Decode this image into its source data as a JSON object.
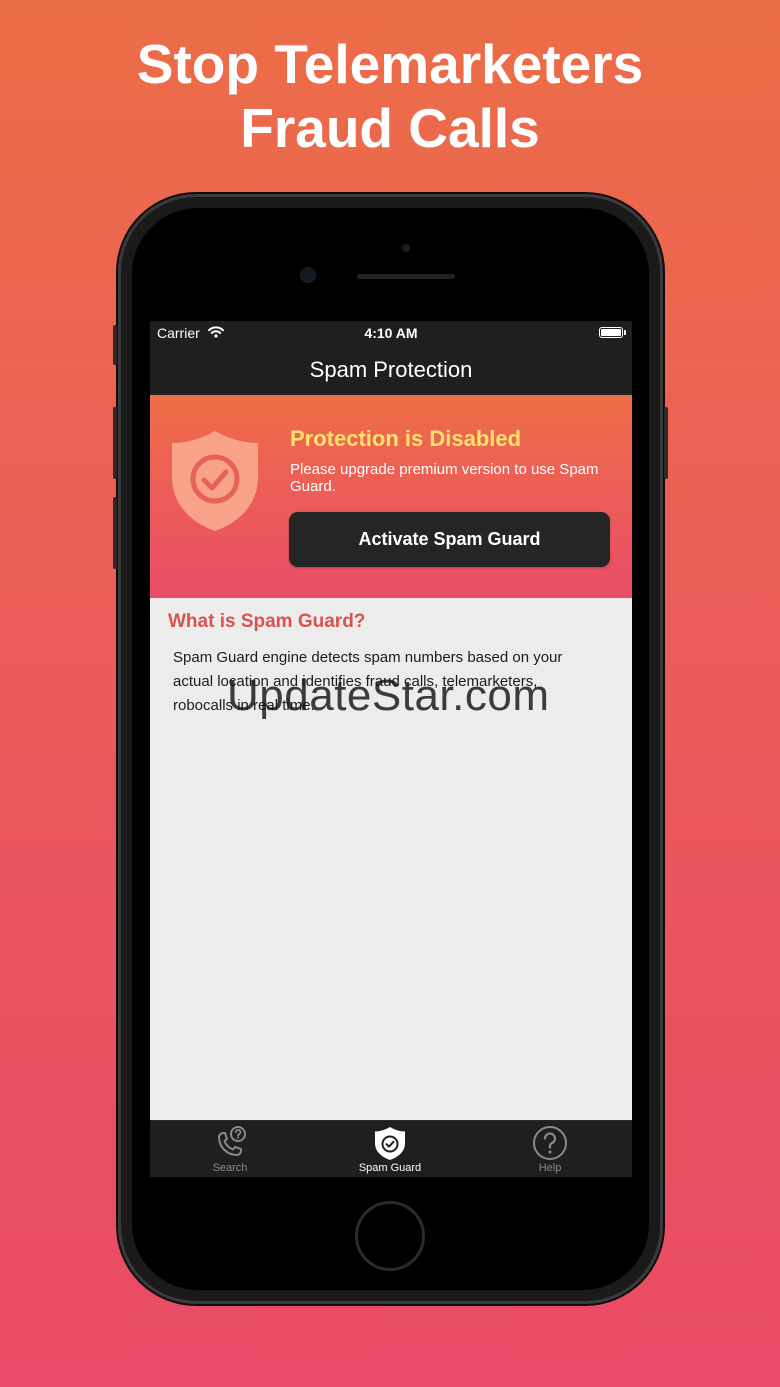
{
  "promo": {
    "headline_line1": "Stop Telemarketers",
    "headline_line2": "Fraud Calls"
  },
  "status_bar": {
    "carrier": "Carrier",
    "time": "4:10 AM"
  },
  "nav": {
    "title": "Spam Protection"
  },
  "banner": {
    "status_title": "Protection is Disabled",
    "status_desc": "Please upgrade premium version to use Spam Guard.",
    "activate_label": "Activate Spam Guard",
    "icon": "shield-check-icon"
  },
  "info": {
    "title": "What is Spam Guard?",
    "body": "Spam Guard engine detects spam numbers based on your actual location and identifies fraud calls, telemarketers, robocalls in real time."
  },
  "watermark": "UpdateStar.com",
  "tabs": [
    {
      "label": "Search",
      "icon": "phone-question-icon",
      "active": false
    },
    {
      "label": "Spam Guard",
      "icon": "shield-check-icon",
      "active": true
    },
    {
      "label": "Help",
      "icon": "help-circle-icon",
      "active": false
    }
  ],
  "colors": {
    "background_top": "#EC6E48",
    "background_bottom": "#E94A66",
    "status_title": "#FFE36E",
    "info_title": "#D9544F",
    "bar_dark": "#1F1F1F",
    "button_dark": "#252525"
  }
}
